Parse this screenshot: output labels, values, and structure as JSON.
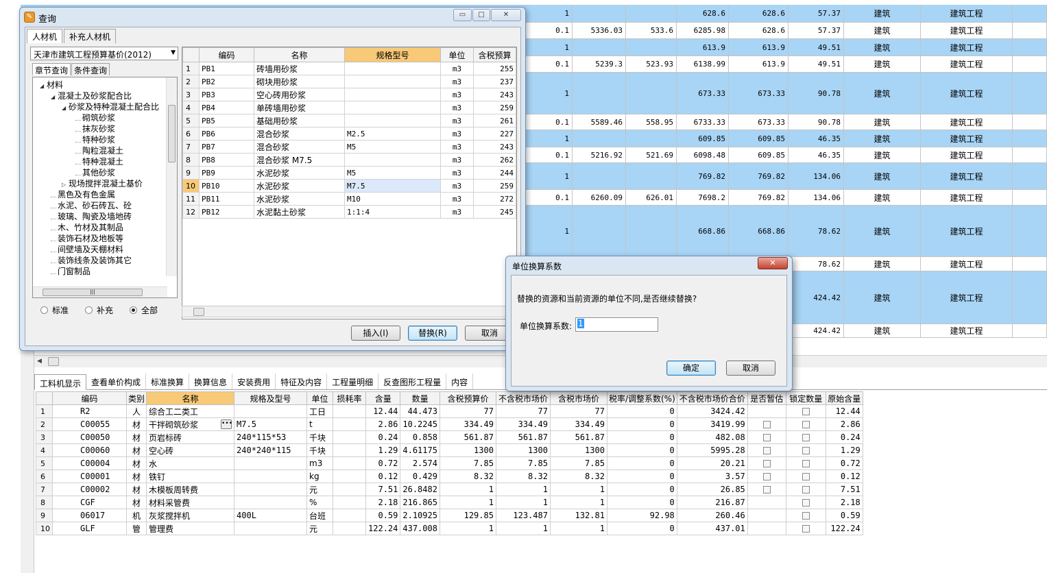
{
  "bg_grid": {
    "rows": [
      {
        "blue": true,
        "h": 26,
        "c1": "1",
        "c2": "",
        "c3": "",
        "c4": "628.6",
        "c5": "628.6",
        "c6": "57.37",
        "c7": "建筑",
        "c8": "建筑工程"
      },
      {
        "blue": false,
        "h": 24,
        "c1": "0.1",
        "c2": "5336.03",
        "c3": "533.6",
        "c4": "6285.98",
        "c5": "628.6",
        "c6": "57.37",
        "c7": "建筑",
        "c8": "建筑工程"
      },
      {
        "blue": true,
        "h": 25,
        "c1": "1",
        "c2": "",
        "c3": "",
        "c4": "613.9",
        "c5": "613.9",
        "c6": "49.51",
        "c7": "建筑",
        "c8": "建筑工程"
      },
      {
        "blue": false,
        "h": 24,
        "c1": "0.1",
        "c2": "5239.3",
        "c3": "523.93",
        "c4": "6138.99",
        "c5": "613.9",
        "c6": "49.51",
        "c7": "建筑",
        "c8": "建筑工程"
      },
      {
        "blue": true,
        "h": 61,
        "c1": "1",
        "c2": "",
        "c3": "",
        "c4": "673.33",
        "c5": "673.33",
        "c6": "90.78",
        "c7": "建筑",
        "c8": "建筑工程"
      },
      {
        "blue": false,
        "h": 23,
        "c1": "0.1",
        "c2": "5589.46",
        "c3": "558.95",
        "c4": "6733.33",
        "c5": "673.33",
        "c6": "90.78",
        "c7": "建筑",
        "c8": "建筑工程"
      },
      {
        "blue": true,
        "h": 25,
        "c1": "1",
        "c2": "",
        "c3": "",
        "c4": "609.85",
        "c5": "609.85",
        "c6": "46.35",
        "c7": "建筑",
        "c8": "建筑工程"
      },
      {
        "blue": false,
        "h": 23,
        "c1": "0.1",
        "c2": "5216.92",
        "c3": "521.69",
        "c4": "6098.48",
        "c5": "609.85",
        "c6": "46.35",
        "c7": "建筑",
        "c8": "建筑工程"
      },
      {
        "blue": true,
        "h": 39,
        "c1": "1",
        "c2": "",
        "c3": "",
        "c4": "769.82",
        "c5": "769.82",
        "c6": "134.06",
        "c7": "建筑",
        "c8": "建筑工程"
      },
      {
        "blue": false,
        "h": 23,
        "c1": "0.1",
        "c2": "6260.09",
        "c3": "626.01",
        "c4": "7698.2",
        "c5": "769.82",
        "c6": "134.06",
        "c7": "建筑",
        "c8": "建筑工程"
      },
      {
        "blue": true,
        "h": 75,
        "c1": "1",
        "c2": "",
        "c3": "",
        "c4": "668.86",
        "c5": "668.86",
        "c6": "78.62",
        "c7": "建筑",
        "c8": "建筑工程"
      },
      {
        "blue": false,
        "h": 21,
        "c1": "",
        "c2": "",
        "c3": "",
        "c4": "",
        "c5": "",
        "c6": "78.62",
        "c7": "建筑",
        "c8": "建筑工程"
      },
      {
        "blue": true,
        "h": 77,
        "c1": "",
        "c2": "",
        "c3": "",
        "c4": "",
        "c5": "",
        "c6": "424.42",
        "c7": "建筑",
        "c8": "建筑工程"
      },
      {
        "blue": false,
        "h": 20,
        "c1": "",
        "c2": "",
        "c3": "",
        "c4": "",
        "c5": "",
        "c6": "424.42",
        "c7": "建筑",
        "c8": "建筑工程"
      }
    ]
  },
  "bottom_tabs": [
    "工料机显示",
    "查看单价构成",
    "标准换算",
    "换算信息",
    "安装费用",
    "特征及内容",
    "工程量明细",
    "反查图形工程量",
    "内容"
  ],
  "bottom_table": {
    "headers": [
      "编码",
      "类别",
      "名称",
      "规格及型号",
      "单位",
      "损耗率",
      "含量",
      "数量",
      "含税预算价",
      "不含税市场价",
      "含税市场价",
      "税率/调整系数(%)",
      "不含税市场价合价",
      "是否暂估",
      "锁定数量",
      "原始含量"
    ],
    "rows": [
      {
        "no": "1",
        "code": "R2",
        "type": "人",
        "name": "综合工二类工",
        "spec": "",
        "unit": "工日",
        "loss": "",
        "qty_rate": "12.44",
        "qty": "44.473",
        "budget": "77",
        "mkt_ex": "77",
        "mkt_in": "77",
        "tax": "0",
        "total": "3424.42",
        "est": false,
        "lock": true,
        "orig": "12.44"
      },
      {
        "no": "2",
        "code": "C00055",
        "type": "材",
        "name": "干拌砌筑砂浆",
        "spec": "M7.5",
        "unit": "t",
        "loss": "",
        "qty_rate": "2.86",
        "qty": "10.2245",
        "budget": "334.49",
        "mkt_ex": "334.49",
        "mkt_in": "334.49",
        "tax": "0",
        "total": "3419.99",
        "est": true,
        "lock": true,
        "orig": "2.86"
      },
      {
        "no": "3",
        "code": "C00050",
        "type": "材",
        "name": "页岩标砖",
        "spec": "240*115*53",
        "unit": "千块",
        "loss": "",
        "qty_rate": "0.24",
        "qty": "0.858",
        "budget": "561.87",
        "mkt_ex": "561.87",
        "mkt_in": "561.87",
        "tax": "0",
        "total": "482.08",
        "est": true,
        "lock": true,
        "orig": "0.24"
      },
      {
        "no": "4",
        "code": "C00060",
        "type": "材",
        "name": "空心砖",
        "spec": "240*240*115",
        "unit": "千块",
        "loss": "",
        "qty_rate": "1.29",
        "qty": "4.61175",
        "budget": "1300",
        "mkt_ex": "1300",
        "mkt_in": "1300",
        "tax": "0",
        "total": "5995.28",
        "est": true,
        "lock": true,
        "orig": "1.29"
      },
      {
        "no": "5",
        "code": "C00004",
        "type": "材",
        "name": "水",
        "spec": "",
        "unit": "m3",
        "loss": "",
        "qty_rate": "0.72",
        "qty": "2.574",
        "budget": "7.85",
        "mkt_ex": "7.85",
        "mkt_in": "7.85",
        "tax": "0",
        "total": "20.21",
        "est": true,
        "lock": true,
        "orig": "0.72"
      },
      {
        "no": "6",
        "code": "C00001",
        "type": "材",
        "name": "铁钉",
        "spec": "",
        "unit": "kg",
        "loss": "",
        "qty_rate": "0.12",
        "qty": "0.429",
        "budget": "8.32",
        "mkt_ex": "8.32",
        "mkt_in": "8.32",
        "tax": "0",
        "total": "3.57",
        "est": true,
        "lock": true,
        "orig": "0.12"
      },
      {
        "no": "7",
        "code": "C00002",
        "type": "材",
        "name": "木模板周转费",
        "spec": "",
        "unit": "元",
        "loss": "",
        "qty_rate": "7.51",
        "qty": "26.8482",
        "budget": "1",
        "mkt_ex": "1",
        "mkt_in": "1",
        "tax": "0",
        "total": "26.85",
        "est": true,
        "lock": true,
        "orig": "7.51"
      },
      {
        "no": "8",
        "code": "CGF",
        "type": "材",
        "name": "材料采管费",
        "spec": "",
        "unit": "%",
        "loss": "",
        "qty_rate": "2.18",
        "qty": "216.865",
        "budget": "1",
        "mkt_ex": "1",
        "mkt_in": "1",
        "tax": "0",
        "total": "216.87",
        "est": false,
        "lock": true,
        "orig": "2.18"
      },
      {
        "no": "9",
        "code": "06017",
        "type": "机",
        "name": "灰浆搅拌机",
        "spec": "400L",
        "unit": "台班",
        "loss": "",
        "qty_rate": "0.59",
        "qty": "2.10925",
        "budget": "129.85",
        "mkt_ex": "123.487",
        "mkt_in": "132.81",
        "tax": "92.98",
        "total": "260.46",
        "est": false,
        "lock": true,
        "orig": "0.59"
      },
      {
        "no": "10",
        "code": "GLF",
        "type": "管",
        "name": "管理费",
        "spec": "",
        "unit": "元",
        "loss": "",
        "qty_rate": "122.24",
        "qty": "437.008",
        "budget": "1",
        "mkt_ex": "1",
        "mkt_in": "1",
        "tax": "0",
        "total": "437.01",
        "est": false,
        "lock": true,
        "orig": "122.24"
      }
    ]
  },
  "query_dialog": {
    "title": "查询",
    "win_buttons": {
      "minimize": "▭",
      "maximize": "□",
      "close": "✕"
    },
    "tabs": [
      "人材机",
      "补充人材机"
    ],
    "db_select": "天津市建筑工程预算基价(2012)",
    "subtabs": [
      "章节查询",
      "条件查询"
    ],
    "tree": [
      {
        "label": "材料",
        "indent": 0,
        "expanded": true
      },
      {
        "label": "混凝土及砂浆配合比",
        "indent": 1,
        "expanded": true
      },
      {
        "label": "砂浆及特种混凝土配合比",
        "indent": 2,
        "expanded": true
      },
      {
        "label": "砌筑砂浆",
        "indent": 3
      },
      {
        "label": "抹灰砂浆",
        "indent": 3
      },
      {
        "label": "特种砂浆",
        "indent": 3
      },
      {
        "label": "陶粒混凝土",
        "indent": 3
      },
      {
        "label": "特种混凝土",
        "indent": 3
      },
      {
        "label": "其他砂浆",
        "indent": 3
      },
      {
        "label": "现场搅拌混凝土基价",
        "indent": 2,
        "collapsed": true
      },
      {
        "label": "黑色及有色金属",
        "indent": 1
      },
      {
        "label": "水泥、砂石砖瓦、砼",
        "indent": 1
      },
      {
        "label": "玻璃、陶瓷及墙地砖",
        "indent": 1
      },
      {
        "label": "木、竹材及其制品",
        "indent": 1
      },
      {
        "label": "装饰石材及地板等",
        "indent": 1
      },
      {
        "label": "间壁墙及天棚材料",
        "indent": 1
      },
      {
        "label": "装饰线条及装饰其它",
        "indent": 1
      },
      {
        "label": "门窗制品",
        "indent": 1
      }
    ],
    "filters": [
      {
        "label": "标准",
        "checked": false
      },
      {
        "label": "补充",
        "checked": false
      },
      {
        "label": "全部",
        "checked": true
      }
    ],
    "grid": {
      "headers": [
        "编码",
        "名称",
        "规格型号",
        "单位",
        "含税预算"
      ],
      "rows": [
        {
          "no": "1",
          "code": "PB1",
          "name": "砖墙用砂浆",
          "spec": "",
          "unit": "m3",
          "price": "255"
        },
        {
          "no": "2",
          "code": "PB2",
          "name": "砌块用砂浆",
          "spec": "",
          "unit": "m3",
          "price": "237"
        },
        {
          "no": "3",
          "code": "PB3",
          "name": "空心砖用砂浆",
          "spec": "",
          "unit": "m3",
          "price": "243"
        },
        {
          "no": "4",
          "code": "PB4",
          "name": "单砖墙用砂浆",
          "spec": "",
          "unit": "m3",
          "price": "259"
        },
        {
          "no": "5",
          "code": "PB5",
          "name": "基础用砂浆",
          "spec": "",
          "unit": "m3",
          "price": "261"
        },
        {
          "no": "6",
          "code": "PB6",
          "name": "混合砂浆",
          "spec": "M2.5",
          "unit": "m3",
          "price": "227"
        },
        {
          "no": "7",
          "code": "PB7",
          "name": "混合砂浆",
          "spec": "M5",
          "unit": "m3",
          "price": "243"
        },
        {
          "no": "8",
          "code": "PB8",
          "name": "混合砂浆 M7.5",
          "spec": "",
          "unit": "m3",
          "price": "262"
        },
        {
          "no": "9",
          "code": "PB9",
          "name": "水泥砂浆",
          "spec": "M5",
          "unit": "m3",
          "price": "244"
        },
        {
          "no": "10",
          "code": "PB10",
          "name": "水泥砂浆",
          "spec": "M7.5",
          "unit": "m3",
          "price": "259",
          "selected": true
        },
        {
          "no": "11",
          "code": "PB11",
          "name": "水泥砂浆",
          "spec": "M10",
          "unit": "m3",
          "price": "272"
        },
        {
          "no": "12",
          "code": "PB12",
          "name": "水泥黏土砂浆",
          "spec": "1:1:4",
          "unit": "m3",
          "price": "245"
        }
      ]
    },
    "buttons": {
      "insert": "插入(I)",
      "replace": "替换(R)",
      "cancel": "取消"
    }
  },
  "unit_dialog": {
    "title": "单位换算系数",
    "close": "✕",
    "message": "替换的资源和当前资源的单位不同,是否继续替换?",
    "field_label": "单位换算系数:",
    "field_value": "1",
    "ok": "确定",
    "cancel": "取消"
  }
}
